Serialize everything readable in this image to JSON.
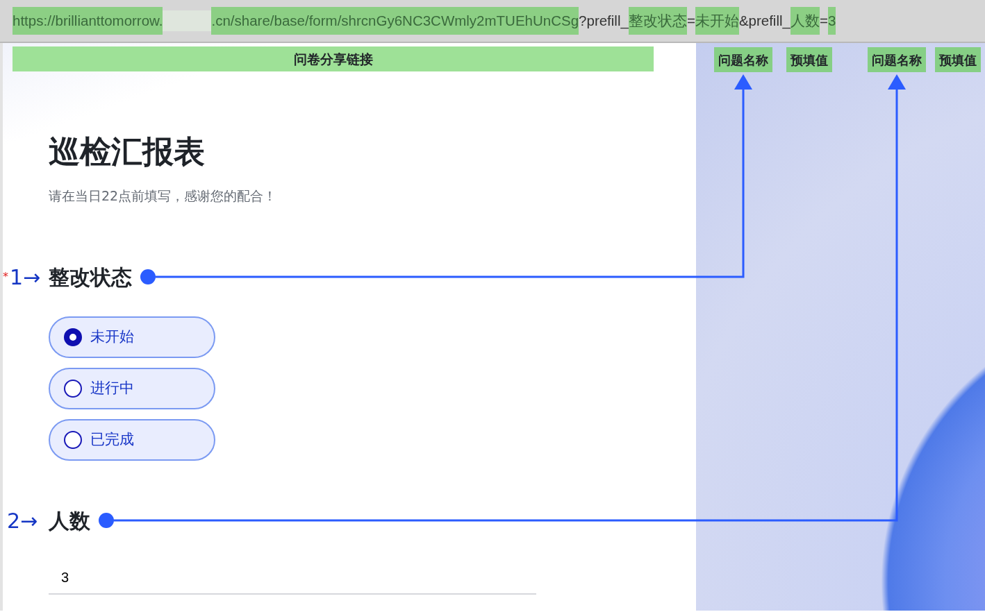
{
  "url_bar": {
    "segments": [
      {
        "kind": "text",
        "text": "https://brillianttomorrow.",
        "highlighted": true
      },
      {
        "kind": "redacted"
      },
      {
        "kind": "text",
        "text": ".cn/share/base/form/shrcnGy6NC3CWmly2mTUEhUnCSg",
        "highlighted": true
      },
      {
        "kind": "text",
        "text": "?prefill_",
        "highlighted": false
      },
      {
        "kind": "text",
        "text": "整改状态",
        "highlighted": true
      },
      {
        "kind": "text",
        "text": "=",
        "highlighted": false
      },
      {
        "kind": "text",
        "text": "未开始",
        "highlighted": true
      },
      {
        "kind": "text",
        "text": "&prefill_",
        "highlighted": false
      },
      {
        "kind": "text",
        "text": "人数",
        "highlighted": true
      },
      {
        "kind": "text",
        "text": "=",
        "highlighted": false
      },
      {
        "kind": "text",
        "text": "3",
        "highlighted": true
      }
    ]
  },
  "annotations": {
    "share_link_label": "问卷分享链接",
    "tags": [
      {
        "text": "问题名称"
      },
      {
        "text": "预填值"
      },
      {
        "text": "问题名称"
      },
      {
        "text": "预填值"
      }
    ]
  },
  "form": {
    "title": "巡检汇报表",
    "description": "请在当日22点前填写，感谢您的配合！",
    "questions": [
      {
        "number": "1→",
        "required_mark": "*",
        "label": "整改状态",
        "kind": "radio",
        "options": [
          {
            "label": "未开始",
            "selected": true
          },
          {
            "label": "进行中",
            "selected": false
          },
          {
            "label": "已完成",
            "selected": false
          }
        ]
      },
      {
        "number": "2→",
        "label": "人数",
        "kind": "text",
        "value": "3"
      }
    ]
  }
}
